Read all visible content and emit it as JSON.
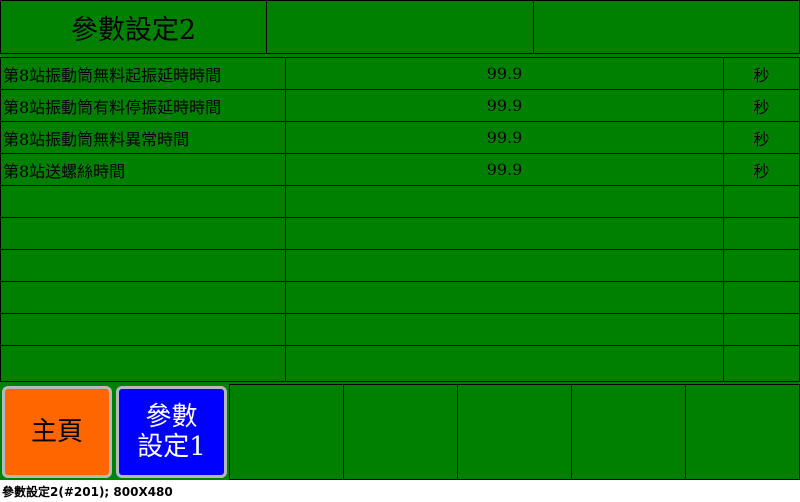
{
  "screen": {
    "title": "參數設定2"
  },
  "params": [
    {
      "label": "第8站振動筒無料起振延時時間",
      "value": "99.9",
      "unit": "秒"
    },
    {
      "label": "第8站振動筒有料停振延時時間",
      "value": "99.9",
      "unit": "秒"
    },
    {
      "label": "第8站振動筒無料異常時間",
      "value": "99.9",
      "unit": "秒"
    },
    {
      "label": "第8站送螺絲時間",
      "value": "99.9",
      "unit": "秒"
    },
    {
      "label": "",
      "value": "",
      "unit": ""
    },
    {
      "label": "",
      "value": "",
      "unit": ""
    },
    {
      "label": "",
      "value": "",
      "unit": ""
    },
    {
      "label": "",
      "value": "",
      "unit": ""
    },
    {
      "label": "",
      "value": "",
      "unit": ""
    },
    {
      "label": "",
      "value": "",
      "unit": ""
    }
  ],
  "buttons": {
    "home": "主頁",
    "param1_line1": "參數",
    "param1_line2": "設定1"
  },
  "colors": {
    "panel": "#008000",
    "home_button": "#ff6600",
    "param_button": "#0000ff"
  },
  "status_bar": "參數設定2(#201); 800X480"
}
